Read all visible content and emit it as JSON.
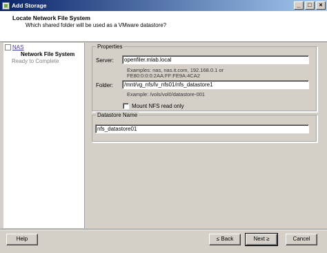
{
  "window": {
    "title": "Add Storage",
    "app_icon": "storage-icon",
    "controls": [
      "minimize-icon",
      "maximize-icon",
      "close-icon"
    ]
  },
  "header": {
    "title": "Locate Network File System",
    "subtitle": "Which shared folder will be used as a VMware datastore?"
  },
  "nav": {
    "items": [
      {
        "label": "NAS",
        "state": "link"
      },
      {
        "label": "Network File System",
        "state": "current"
      },
      {
        "label": "Ready to Complete",
        "state": "disabled"
      }
    ]
  },
  "properties": {
    "legend": "Properties",
    "server_label": "Server:",
    "server_value": "openfiler.mlab.local",
    "server_hint_1": "Examples: nas, nas.it.com, 192.168.0.1 or",
    "server_hint_2": "FE80:0:0:0:2AA:FF:FE9A:4CA2",
    "folder_label": "Folder:",
    "folder_value": "/mnt/vg_nfs/lv_nfs01/nfs_datastore1",
    "folder_hint": "Example: /vols/vol0/datastore-001",
    "mount_ro_label": "Mount NFS read only",
    "mount_ro_checked": false
  },
  "datastore": {
    "legend": "Datastore Name",
    "value": "nfs_datastore01"
  },
  "buttons": {
    "help": "Help",
    "back": "≤ Back",
    "next": "Next ≥",
    "cancel": "Cancel"
  }
}
